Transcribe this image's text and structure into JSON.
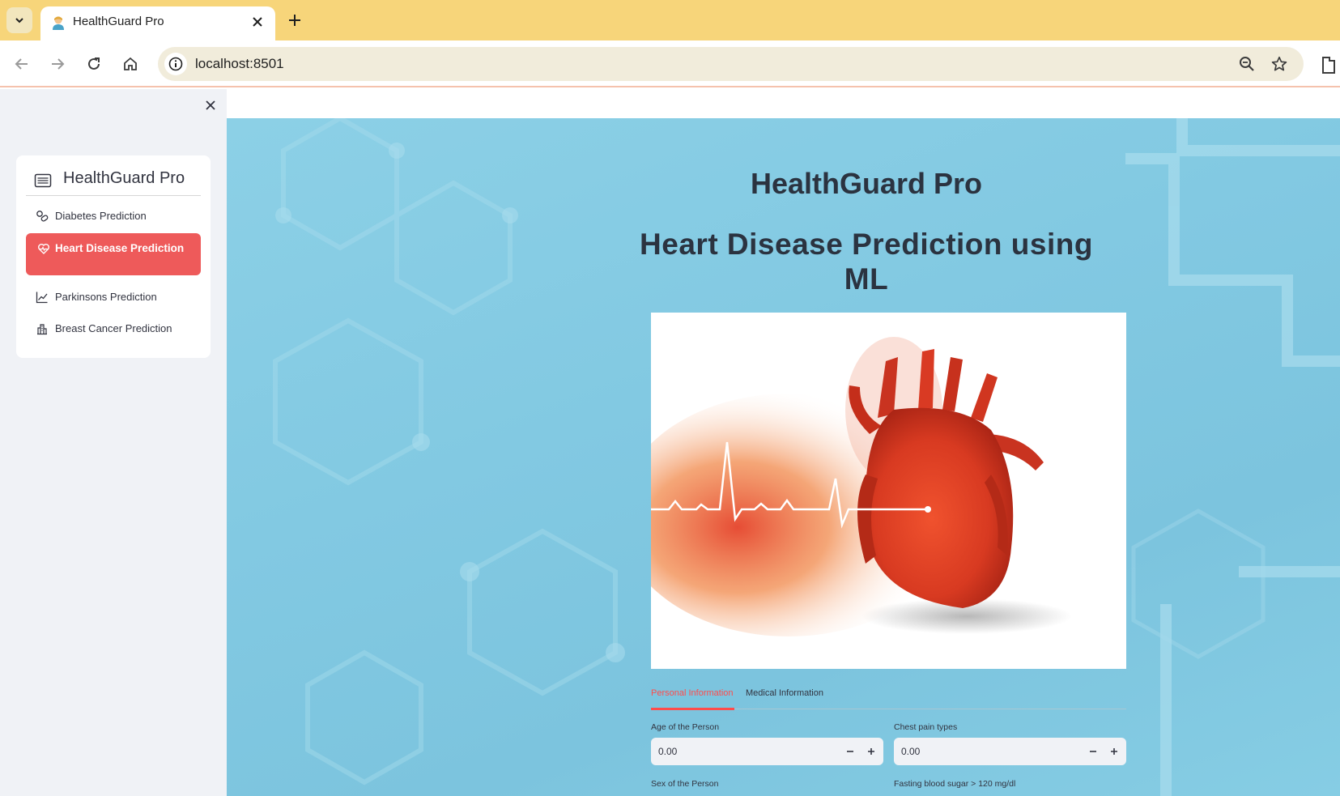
{
  "browser": {
    "tab_title": "HealthGuard Pro",
    "url": "localhost:8501"
  },
  "sidebar": {
    "menu_title": "HealthGuard Pro",
    "items": [
      {
        "label": "Diabetes Prediction",
        "icon": "pills-icon",
        "active": false
      },
      {
        "label": "Heart Disease Prediction",
        "icon": "heart-pulse-icon",
        "active": true
      },
      {
        "label": "Parkinsons Prediction",
        "icon": "graph-up-icon",
        "active": false
      },
      {
        "label": "Breast Cancer Prediction",
        "icon": "building-icon",
        "active": false
      }
    ],
    "active_color": "#ee5a5a"
  },
  "main": {
    "app_title": "HealthGuard Pro",
    "heading": "Heart Disease Prediction using ML",
    "tabs": [
      {
        "label": "Personal Information",
        "active": true
      },
      {
        "label": "Medical Information",
        "active": false
      }
    ],
    "fields": [
      {
        "label": "Age of the Person",
        "value": "0.00"
      },
      {
        "label": "Chest pain types",
        "value": "0.00"
      },
      {
        "label": "Sex of the Person"
      },
      {
        "label": "Fasting blood sugar > 120 mg/dl"
      }
    ],
    "accent_color": "#ff4b4b"
  }
}
